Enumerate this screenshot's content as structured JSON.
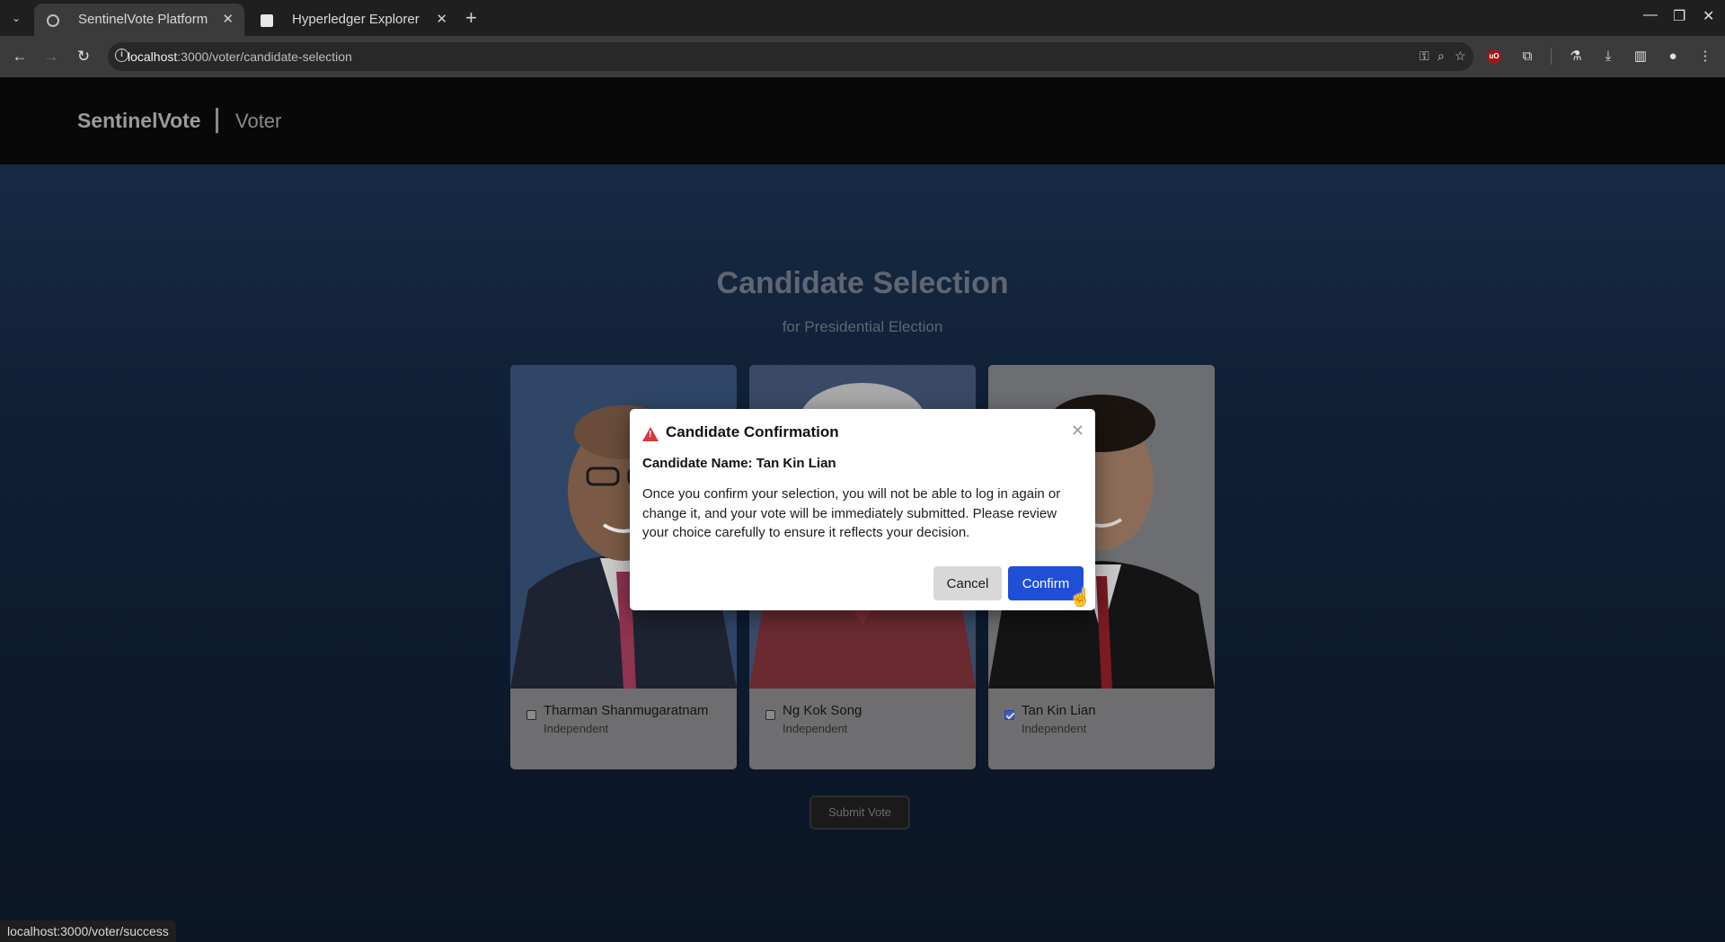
{
  "browser": {
    "tabs": [
      {
        "title": "SentinelVote Platform",
        "active": true
      },
      {
        "title": "Hyperledger Explorer",
        "active": false
      }
    ],
    "url_host": "localhost",
    "url_rest": ":3000/voter/candidate-selection",
    "status_url": "localhost:3000/voter/success"
  },
  "header": {
    "brand": "SentinelVote",
    "role": "Voter"
  },
  "page": {
    "title": "Candidate Selection",
    "subtitle": "for Presidential Election",
    "submit_label": "Submit Vote"
  },
  "candidates": [
    {
      "name": "Tharman Shanmugaratnam",
      "party": "Independent",
      "selected": false
    },
    {
      "name": "Ng Kok Song",
      "party": "Independent",
      "selected": false
    },
    {
      "name": "Tan Kin Lian",
      "party": "Independent",
      "selected": true
    }
  ],
  "modal": {
    "title": "Candidate Confirmation",
    "name_line": "Candidate Name: Tan Kin Lian",
    "body": "Once you confirm your selection, you will not be able to log in again or change it, and your vote will be immediately submitted. Please review your choice carefully to ensure it reflects your decision.",
    "cancel_label": "Cancel",
    "confirm_label": "Confirm"
  },
  "colors": {
    "accent": "#1f4fd6",
    "warning": "#d63a3a"
  }
}
